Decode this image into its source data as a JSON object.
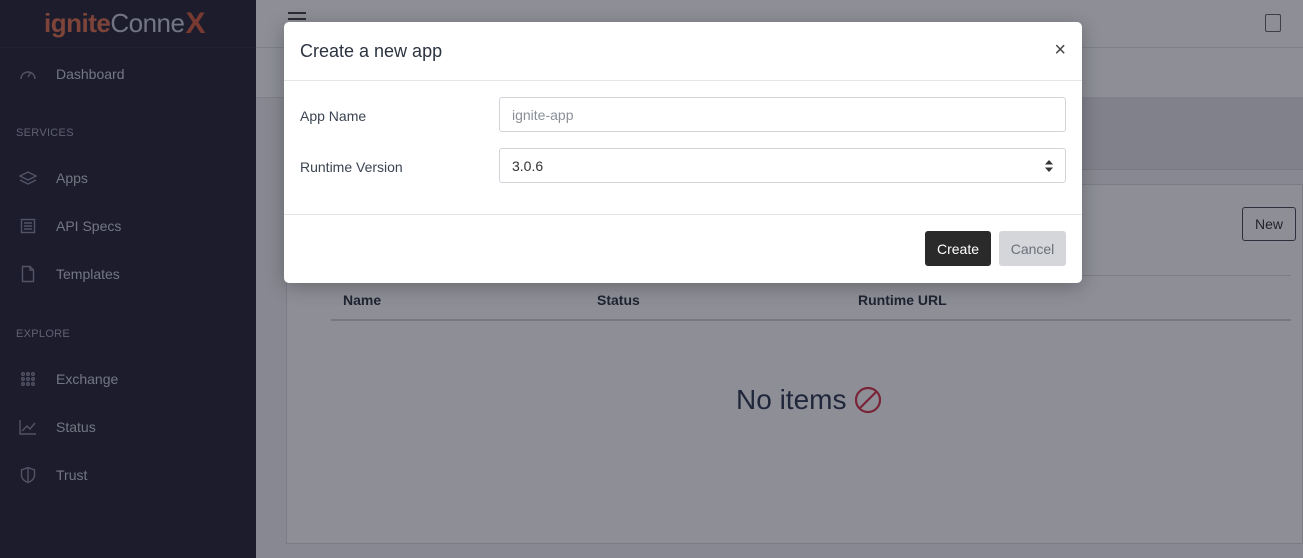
{
  "brand": {
    "part1": "ignite",
    "part2": "Conne",
    "part3": "X"
  },
  "sidebar": {
    "dashboard": "Dashboard",
    "services_heading": "SERVICES",
    "services": [
      {
        "label": "Apps",
        "icon": "layers-icon"
      },
      {
        "label": "API Specs",
        "icon": "document-list-icon"
      },
      {
        "label": "Templates",
        "icon": "file-icon"
      }
    ],
    "explore_heading": "EXPLORE",
    "explore": [
      {
        "label": "Exchange",
        "icon": "grid-dots-icon"
      },
      {
        "label": "Status",
        "icon": "chart-line-icon"
      },
      {
        "label": "Trust",
        "icon": "shield-icon"
      }
    ]
  },
  "main": {
    "new_button": "New",
    "table": {
      "columns": [
        "Name",
        "Status",
        "Runtime URL"
      ]
    },
    "empty_text": "No items"
  },
  "modal": {
    "title": "Create a new app",
    "close_label": "×",
    "app_name_label": "App Name",
    "app_name_placeholder": "ignite-app",
    "runtime_label": "Runtime Version",
    "runtime_value": "3.0.6",
    "create_label": "Create",
    "cancel_label": "Cancel"
  },
  "colors": {
    "sidebar_bg": "#272536",
    "brand_orange": "#e2714d",
    "empty_icon": "#d9344b",
    "primary_button": "#2a2a2a"
  }
}
